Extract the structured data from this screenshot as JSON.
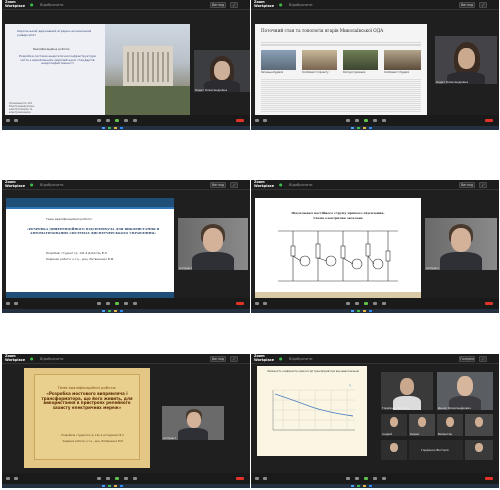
{
  "app_name": "Zoom Workplace",
  "share_label": "Відобразити",
  "view_labels": {
    "gallery": "Галерея",
    "speaker": "Вигляд"
  },
  "screens": [
    {
      "slide": {
        "university": "Херсонський державний аграрно-економічний університет",
        "heading": "Кваліфікаційна робота:",
        "topic": "Розробка системи енергетичної інфраструктури міста з виробленням європейських стандартів енергоефективності",
        "footer": "Спеціальність 141 Електроенергетика, електротехніка та електромеханіка"
      },
      "participant": "Кадет Олександрівна"
    },
    {
      "slide": {
        "title": "Поточний стан та топологія ягарів Миколаївської ОДА",
        "col_heads": [
          "Загальна будівля",
          "Особливості проекту",
          "Реструктуризація",
          "Особливості будівлі"
        ]
      },
      "participant": "Кадет Олександрівна"
    },
    {
      "slide": {
        "small": "Тема кваліфікаційної роботи:",
        "topic": "«РОЗРОБКА ДИФЕРЕНЦІЙНОГО ПІДСИЛЮВАЧА ДЛЯ ВИКОРИСТАННЯ В АВТОМАТИЗОВАНИХ СИСТЕМАХ ДИСПЕТЧЕРСЬКОГО УПРАВЛІННЯ»",
        "author": "Розробив: студент гр. 141-4 Д.Кисіль В.Л",
        "supervisor": "Керівник роботи: к.т.н., доц. Литвиненко В.М."
      },
      "participant": "Аспірант"
    },
    {
      "slide": {
        "title": "Підсилювач постійного струму прямого підсилення.",
        "subtitle": "Схема електрична загальна"
      },
      "participant": "Аспірант"
    },
    {
      "slide": {
        "small": "Тема кваліфікаційної роботи:",
        "topic": "«Розробка мостового випрямляча і трансформатора, що його живить, для використання в пристроях релейного захисту електричних мереж»",
        "author": "Розробила студентка гр. 141-4 д.Гордієнко В.С.",
        "supervisor": "Керівник роботи: к.т.н., доц. Литвиненко В.М."
      },
      "participant": "Аспірант"
    },
    {
      "slide": {
        "title": "Залежність коефіцієнта корисної дії трансформатора від навантаження",
        "legend": "η"
      },
      "participants": [
        "Гордієнко Вікторія",
        "Денис Олександрович",
        "Андрій",
        "Кирил",
        "Валентин",
        "Гордієнко Вікторія"
      ]
    }
  ]
}
